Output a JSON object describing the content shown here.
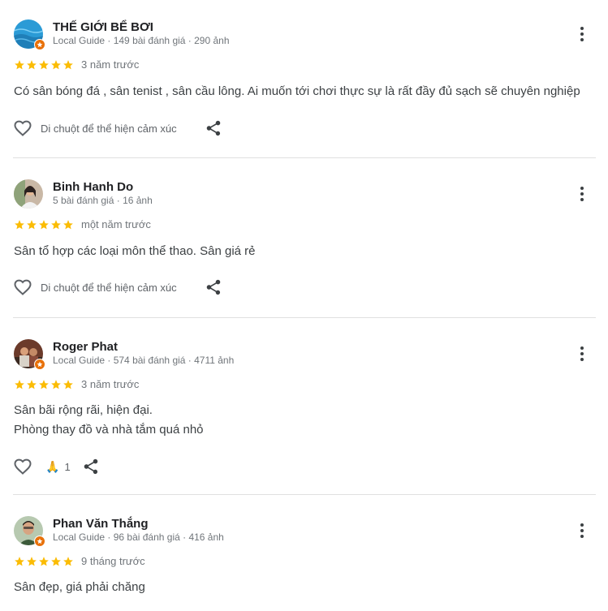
{
  "colors": {
    "star": "#fbbc04",
    "text": "#3c4043",
    "meta": "#70757a",
    "divider": "#e0e0e0",
    "badge": "#e8710a"
  },
  "reviews": [
    {
      "name": "THẾ GIỚI BỂ BƠI",
      "meta": "Local Guide · 149 bài đánh giá · 290 ảnh",
      "stars": 5,
      "time": "3 năm trước",
      "text_lines": [
        "Có sân bóng đá , sân tenist , sân cầu lông. Ai muốn tới chơi thực sự là rất đầy đủ sạch sẽ chuyên nghiệp"
      ],
      "hint": "Di chuột để thể hiện cảm xúc",
      "icons": [
        "heart-outline-icon",
        "share-icon",
        "more-vert-icon"
      ]
    },
    {
      "name": "Binh Hanh Do",
      "meta": "5 bài đánh giá · 16 ảnh",
      "stars": 5,
      "time": "một năm trước",
      "text_lines": [
        "Sân tổ hợp các loại môn thể thao. Sân giá rẻ"
      ],
      "hint": "Di chuột để thể hiện cảm xúc",
      "icons": [
        "heart-outline-icon",
        "share-icon",
        "more-vert-icon"
      ]
    },
    {
      "name": "Roger Phat",
      "meta": "Local Guide · 574 bài đánh giá · 4711 ảnh",
      "stars": 5,
      "time": "3 năm trước",
      "text_lines": [
        "Sân bãi rộng rãi, hiện đại.",
        "Phòng thay đồ và nhà tắm quá nhỏ"
      ],
      "reaction": {
        "emoji": "🙏",
        "count": "1"
      },
      "icons": [
        "heart-outline-icon",
        "pray-emoji-icon",
        "share-icon",
        "more-vert-icon"
      ]
    },
    {
      "name": "Phan Văn Thắng",
      "meta": "Local Guide · 96 bài đánh giá · 416 ảnh",
      "stars": 5,
      "time": "9 tháng trước",
      "text_lines": [
        "Sân đẹp, giá phải chăng"
      ],
      "icons": [
        "more-vert-icon"
      ]
    }
  ]
}
